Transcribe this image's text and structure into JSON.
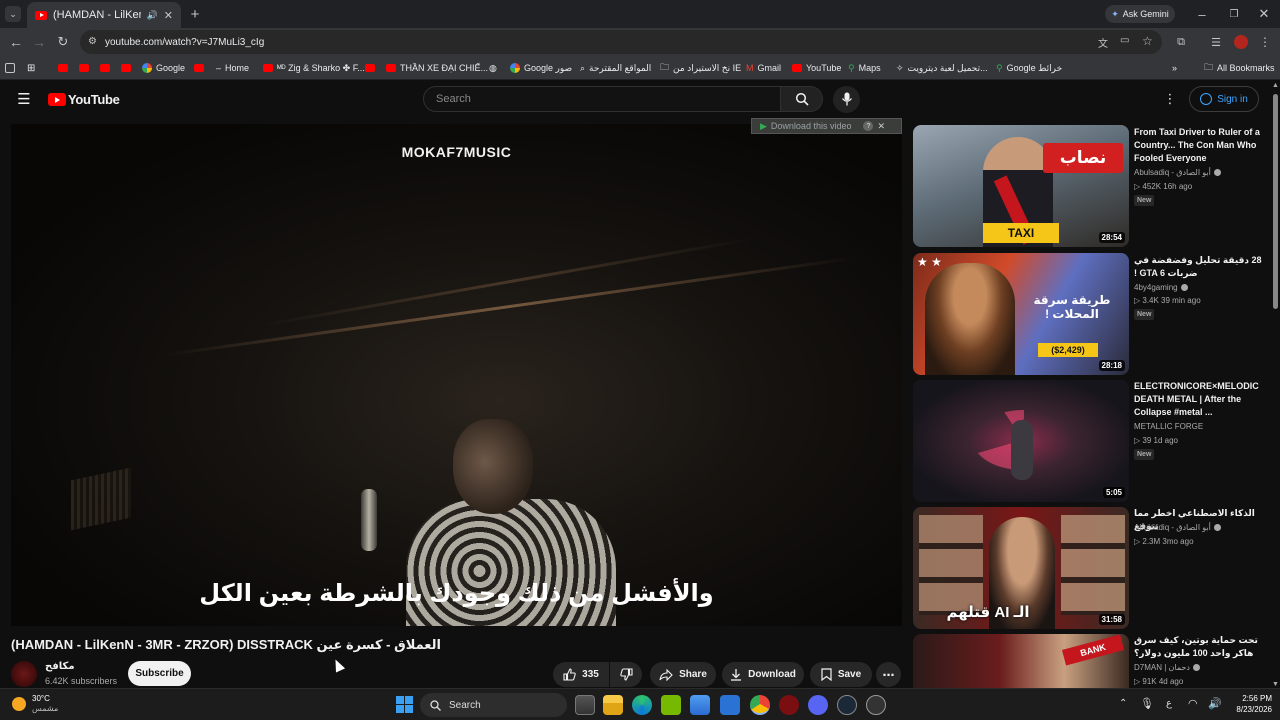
{
  "browser": {
    "tab_title": "(HAMDAN - LilKenN - 3MR",
    "url": "youtube.com/watch?v=J7MuLi3_cIg",
    "ask_gemini": "Ask Gemini",
    "bookmarks": [
      "Google",
      "Home",
      "ᴹᴰ Zig & Sharko ✤ F...",
      "THẦN XE ĐẠI CHIẾ...",
      "Google صور",
      "المواقع المقترحة",
      "نخ الاستيراد من IE",
      "Gmail",
      "YouTube",
      "Maps",
      "تحميل لعبة ديترويت...",
      "Google خرائط"
    ],
    "all_bookmarks": "All Bookmarks"
  },
  "youtube": {
    "logo_text": "YouTube",
    "search_placeholder": "Search",
    "sign_in": "Sign in",
    "download_bar": "Download this video",
    "download_bar_help": "?"
  },
  "video": {
    "watermark": "MOKAF7MUSIC",
    "caption": "والأفشل من ذلك وجودك بالشرطة بعين الكل",
    "title": "(HAMDAN - LilKenN - 3MR - ZRZOR) DISSTRACK العملاق - كسرة عين",
    "channel_name": "مكافح",
    "subscribers": "6.42K subscribers",
    "subscribe": "Subscribe",
    "likes": "335",
    "share": "Share",
    "download": "Download",
    "save": "Save"
  },
  "recommendations": [
    {
      "title": "From Taxi Driver to Ruler of a Country... The Con Man Who Fooled Everyone",
      "channel": "Abulsadiq - أبو الصادق",
      "meta": "452K  16h ago",
      "badge": "New",
      "duration": "28:54",
      "thumb_text": "نصاب",
      "thumb_subtext": "TAXI"
    },
    {
      "title": "28 دقيقة تحليل وفضفضة في ضربات GTA 6 !",
      "channel": "4by4gaming",
      "meta": "3.4K  39 min ago",
      "badge": "New",
      "duration": "28:18",
      "thumb_text": "طريقة سرقة المحلات !",
      "thumb_subtext": "($2,429)"
    },
    {
      "title": "ELECTRONICORE×MELODIC DEATH METAL | After the Collapse #metal ...",
      "channel": "METALLIC FORGE",
      "meta": "39  1d ago",
      "badge": "New",
      "duration": "5:05",
      "thumb_text": "",
      "thumb_subtext": ""
    },
    {
      "title": "الذكاء الاصطناعي اخطر مما تتوقع",
      "channel": "Abulsadiq - أبو الصادق",
      "meta": "2.3M  3mo ago",
      "badge": "",
      "duration": "31:58",
      "thumb_text": "الـ AI قتلهم",
      "thumb_subtext": ""
    },
    {
      "title": "تحت حماية بوتين، كيف سرق هاكر واحد 100 مليون دولار؟",
      "channel": "D7MAN | دحمان",
      "meta": "91K  4d ago",
      "badge": "",
      "duration": "",
      "thumb_text": "BANK",
      "thumb_subtext": ""
    }
  ],
  "taskbar": {
    "weather_temp": "30°C",
    "weather_desc": "مشمس",
    "search": "Search",
    "lang": "ع",
    "time": "2:56 PM",
    "date": "8/23/2026"
  },
  "colors": {
    "brand_red": "#ff0000",
    "link_blue": "#3ea6ff",
    "bg": "#0f0f0f"
  }
}
